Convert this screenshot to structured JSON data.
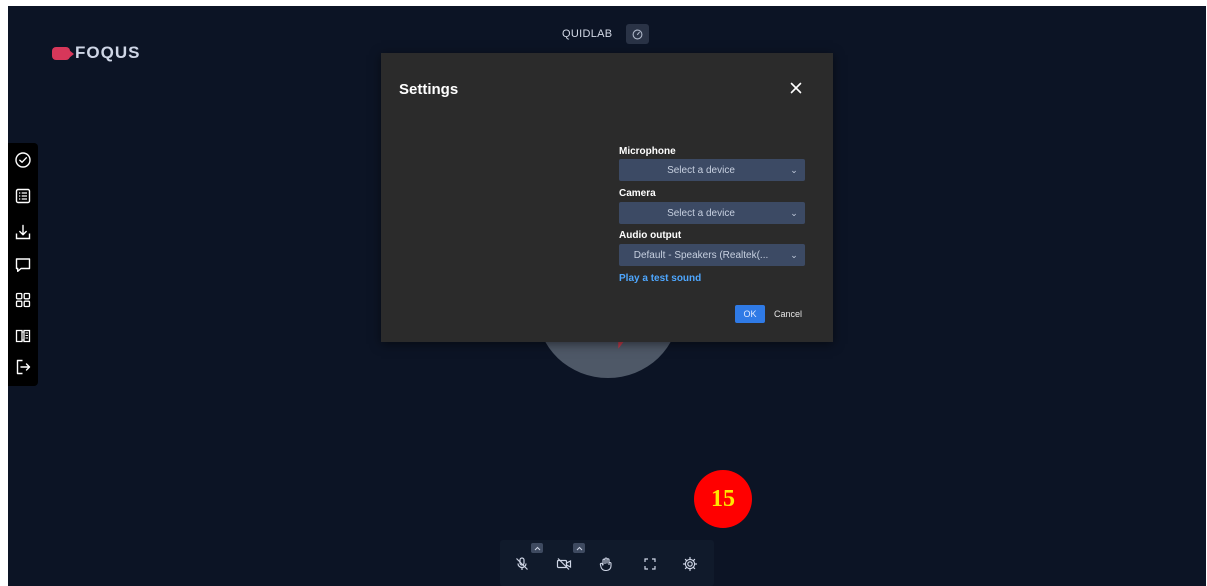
{
  "app": {
    "logo_text": "FOQUS",
    "room_name": "QUIDLAB",
    "room_badge_icon": "gauge-icon"
  },
  "sidebar": {
    "items": [
      {
        "icon": "check-circle-icon"
      },
      {
        "icon": "list-icon"
      },
      {
        "icon": "download-icon"
      },
      {
        "icon": "chat-icon"
      },
      {
        "icon": "grid-icon"
      },
      {
        "icon": "book-icon"
      },
      {
        "icon": "exit-icon"
      }
    ]
  },
  "settings": {
    "title": "Settings",
    "microphone_label": "Microphone",
    "microphone_value": "Select a device",
    "camera_label": "Camera",
    "camera_value": "Select a device",
    "audio_output_label": "Audio output",
    "audio_output_value": "Default - Speakers (Realtek(...",
    "test_sound_link": "Play a test sound",
    "ok_label": "OK",
    "cancel_label": "Cancel"
  },
  "annotation": {
    "step_number": "15"
  },
  "toolbar": {
    "items": [
      "mic-off-icon",
      "camera-off-icon",
      "raise-hand-icon",
      "fullscreen-icon",
      "settings-gear-icon"
    ]
  },
  "colors": {
    "background": "#0c1425",
    "modal": "#2b2b2b",
    "select": "#3c4a64",
    "accent": "#2f7ae6",
    "link": "#4ea7ff",
    "brand": "#d7375a"
  }
}
